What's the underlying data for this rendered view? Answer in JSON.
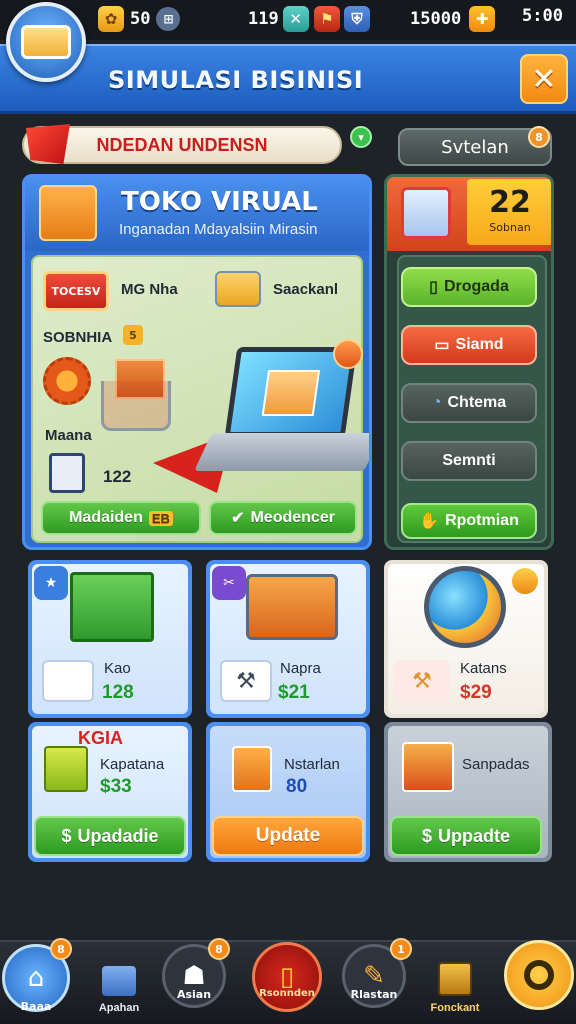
{
  "status": {
    "coins": "50",
    "level": "119",
    "resources": "15000",
    "time": "5:00"
  },
  "header": {
    "title": "SIMULASI BISINISI",
    "close_icon": "✕"
  },
  "banner": {
    "text": "NDEDAN UNDENSN",
    "sort_label": "Svtelan",
    "sort_badge": "8"
  },
  "store": {
    "title": "TOKO VIRUAL",
    "subtitle": "Inganadan Mdayalsiin Mirasin",
    "items": {
      "sign_text": "TOCESV",
      "label_a": "MG Nha",
      "label_b": "Saackanl",
      "label_c": "SOBNHIA",
      "label_d": "Maana",
      "count": "122"
    },
    "buttons": {
      "left": "Madaiden",
      "left_badge": "EB",
      "right": "Meodencer"
    }
  },
  "side": {
    "timer_value": "22",
    "timer_label": "Sobnan",
    "buttons": [
      {
        "label": "Drogada"
      },
      {
        "label": "Siamd"
      },
      {
        "label": "Chtema"
      },
      {
        "label": "Semnti"
      },
      {
        "label": "Rpotmian"
      }
    ]
  },
  "cards": [
    {
      "name": "Kao",
      "price": "128"
    },
    {
      "name": "Napra",
      "price": "$21"
    },
    {
      "name": "Katans",
      "price": "$29"
    },
    {
      "name": "Kapatana",
      "price": "$33",
      "tag": "KGIA"
    },
    {
      "name": "Nstarlan",
      "price": "80"
    },
    {
      "name": "Sanpadas",
      "price": ""
    }
  ],
  "update_buttons": {
    "left": "Upadadie",
    "middle": "Update",
    "right": "Uppadte"
  },
  "nav": {
    "items": [
      {
        "label": "Baaa",
        "badge": "8"
      },
      {
        "label": "Apahan"
      },
      {
        "label": "Asian",
        "badge": "8"
      },
      {
        "label": "Rsonnden"
      },
      {
        "label": "Rlastan",
        "badge": "1"
      },
      {
        "label": "Fonckant"
      }
    ]
  },
  "colors": {
    "header_blue": "#2d6fd4",
    "accent_orange": "#f28a12",
    "green_button": "#3aa52a",
    "price_green": "#1f9a2c",
    "price_red": "#d8342a",
    "price_blue": "#1d4fb0"
  }
}
